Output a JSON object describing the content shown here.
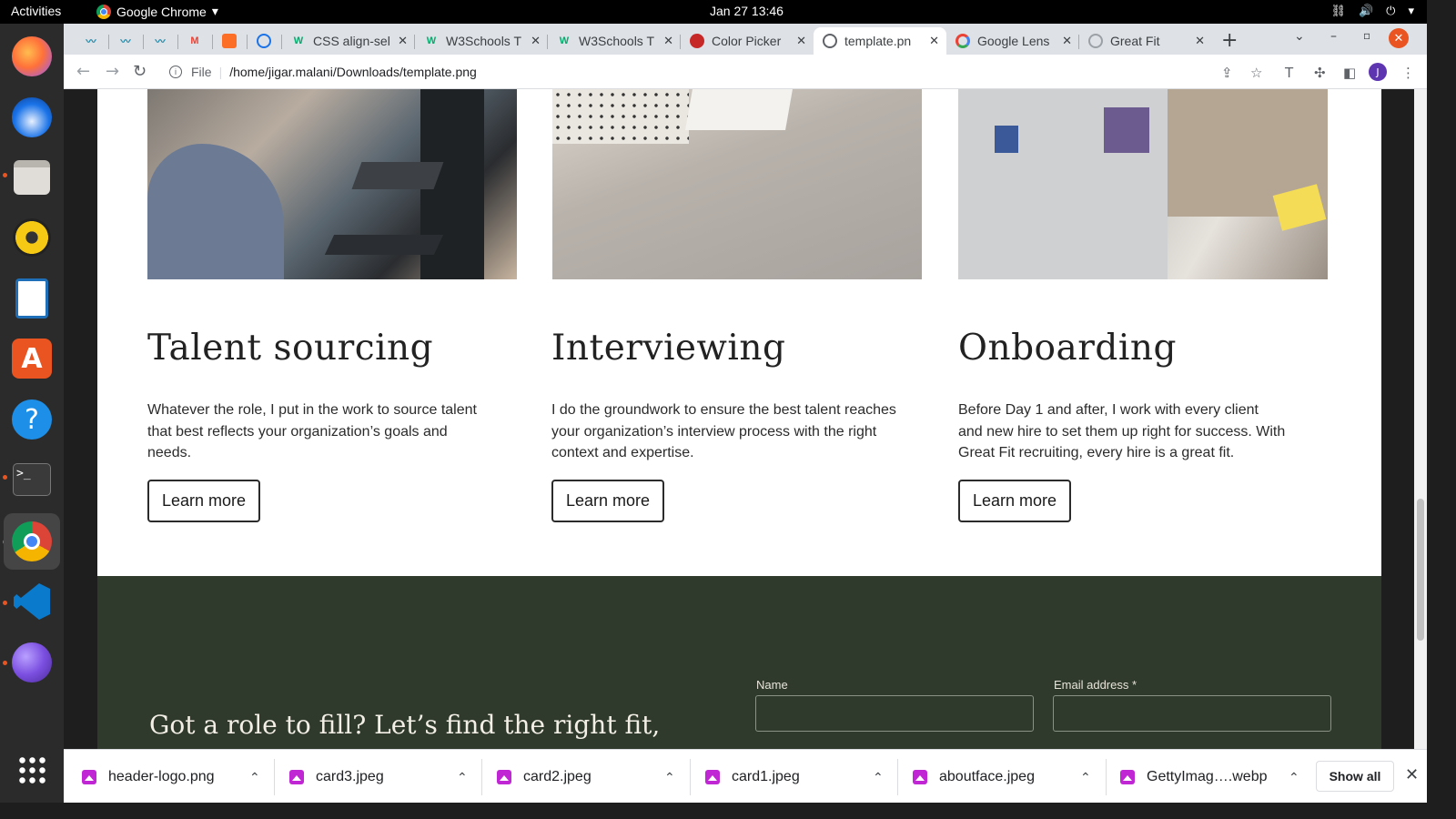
{
  "system": {
    "activities": "Activities",
    "app_name": "Google Chrome",
    "clock": "Jan 27  13:46"
  },
  "tabs": [
    {
      "title": "",
      "icon": "tab-icon-1"
    },
    {
      "title": "",
      "icon": "tab-icon-2"
    },
    {
      "title": "",
      "icon": "tab-icon-3"
    },
    {
      "title": "",
      "icon": "gmail-icon"
    },
    {
      "title": "",
      "icon": "gitlab-icon"
    },
    {
      "title": "",
      "icon": "tab-icon-6"
    },
    {
      "title": "CSS align-sel",
      "icon": "w3schools-icon"
    },
    {
      "title": "W3Schools T",
      "icon": "w3schools-icon"
    },
    {
      "title": "W3Schools T",
      "icon": "w3schools-icon"
    },
    {
      "title": "Color Picker",
      "icon": "colorpicker-icon"
    },
    {
      "title": "template.pn",
      "icon": "globe-icon",
      "active": true
    },
    {
      "title": "Google Lens",
      "icon": "google-lens-icon"
    },
    {
      "title": "Great Fit",
      "icon": "globe-icon"
    }
  ],
  "omnibox": {
    "scheme": "File",
    "url": "/home/jigar.malani/Downloads/template.png"
  },
  "profile_initial": "J",
  "cards": [
    {
      "title": "Talent sourcing",
      "body": "Whatever the role, I put in the work to source talent that best reflects your organization’s goals and needs.",
      "button": "Learn more"
    },
    {
      "title": "Interviewing",
      "body": "I do the groundwork to ensure the best talent reaches your organization’s interview process with the right context and expertise.",
      "button": "Learn more"
    },
    {
      "title": "Onboarding",
      "body": "Before Day 1 and after, I work with every client and new hire to set them up right for success. With Great Fit recruiting, every hire is a great fit.",
      "button": "Learn more"
    }
  ],
  "contact": {
    "heading": "Got a role to fill? Let’s find the right fit,",
    "name_label": "Name",
    "email_label": "Email address *"
  },
  "downloads": [
    {
      "file": "header-logo.png"
    },
    {
      "file": "card3.jpeg"
    },
    {
      "file": "card2.jpeg"
    },
    {
      "file": "card1.jpeg"
    },
    {
      "file": "aboutface.jpeg"
    },
    {
      "file": "GettyImag….webp"
    }
  ],
  "show_all": "Show all",
  "colors": {
    "accent_footer": "#2f3a2c",
    "ubuntu_orange": "#e95420"
  }
}
